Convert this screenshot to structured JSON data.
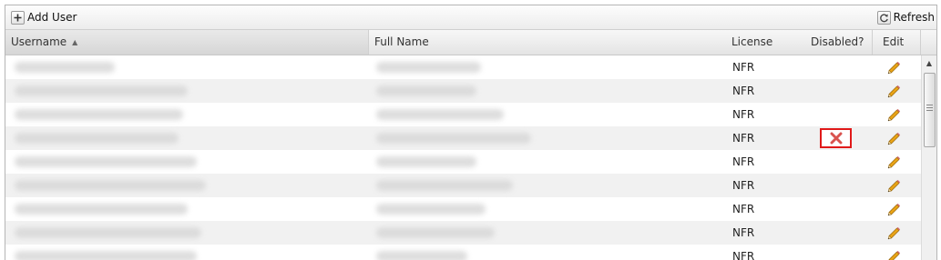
{
  "toolbar": {
    "add_user_label": "Add User",
    "refresh_label": "Refresh"
  },
  "columns": {
    "username": "Username",
    "full_name": "Full Name",
    "license": "License",
    "disabled": "Disabled?",
    "edit": "Edit"
  },
  "rows": [
    {
      "license": "NFR",
      "disabled": false
    },
    {
      "license": "NFR",
      "disabled": false
    },
    {
      "license": "NFR",
      "disabled": false
    },
    {
      "license": "NFR",
      "disabled": true
    },
    {
      "license": "NFR",
      "disabled": false
    },
    {
      "license": "NFR",
      "disabled": false
    },
    {
      "license": "NFR",
      "disabled": false
    },
    {
      "license": "NFR",
      "disabled": false
    },
    {
      "license": "NFR",
      "disabled": false
    }
  ],
  "colors": {
    "accent_red": "#e01919",
    "disabled_x": "#d9534f",
    "pencil": "#e8a317"
  },
  "icons": {
    "add": "plus-icon",
    "refresh": "refresh-icon",
    "edit": "pencil-icon",
    "disabled": "x-mark-icon",
    "sort": "sort-asc-icon"
  }
}
